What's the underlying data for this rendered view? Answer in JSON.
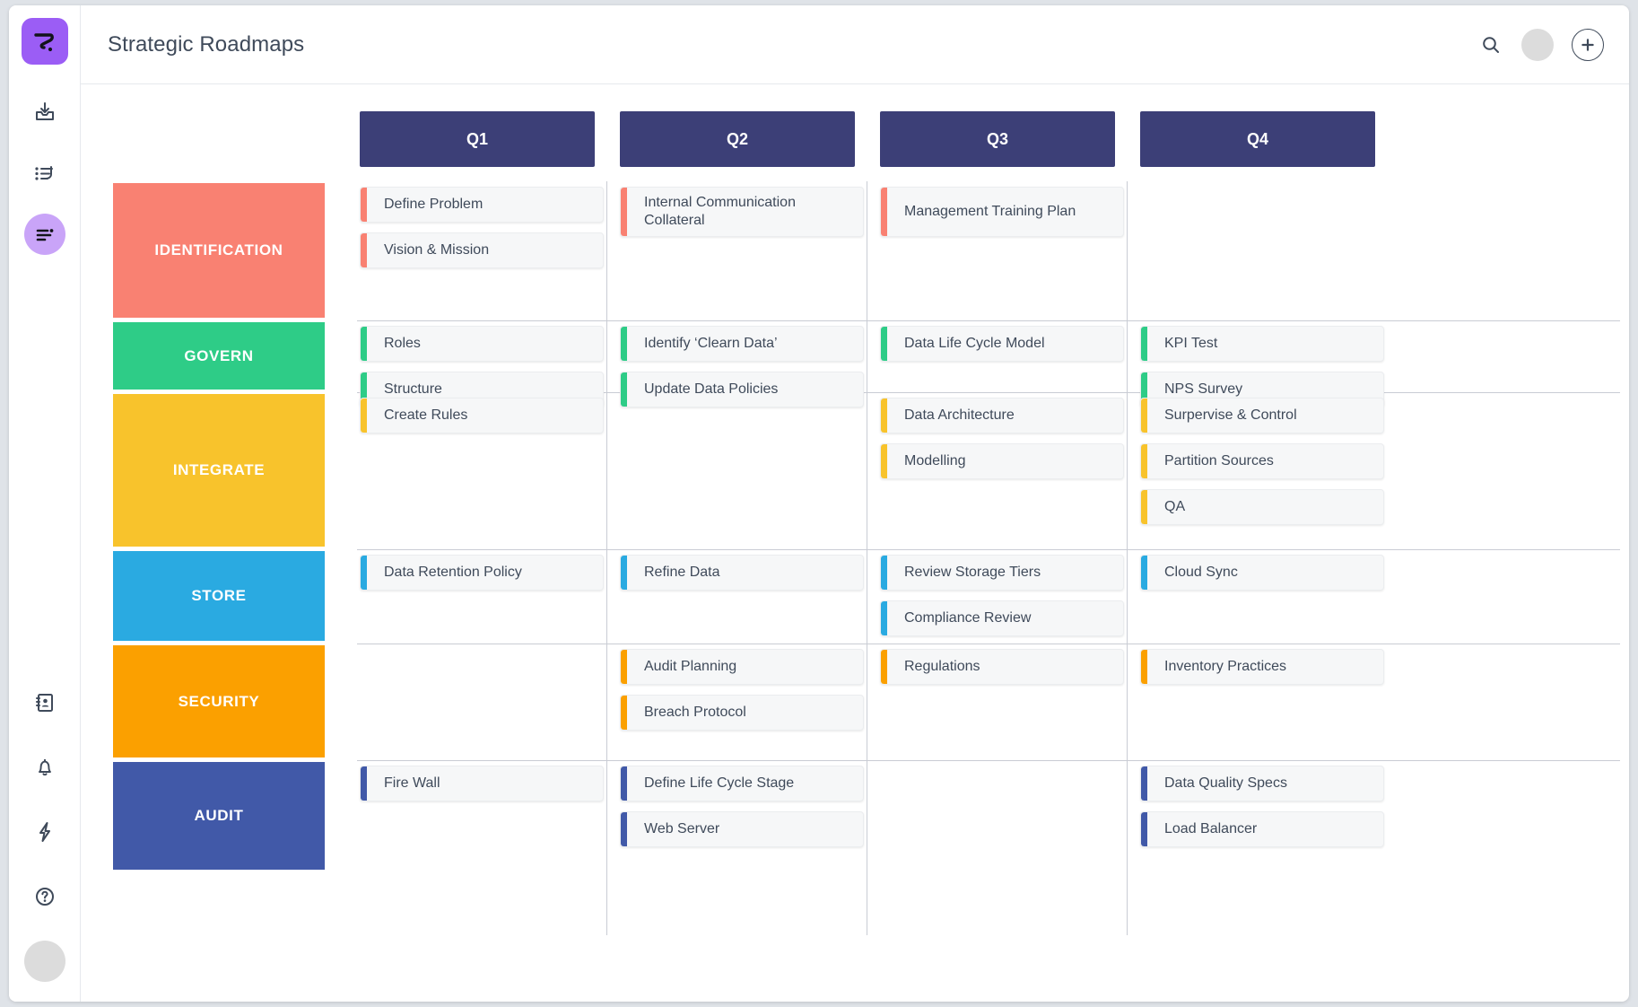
{
  "window": {
    "title": "Strategic Roadmaps"
  },
  "sidebar": {
    "logo": {
      "name": "app-logo",
      "glyph": "logo-squiggle"
    },
    "items": [
      {
        "id": "inbox-download",
        "icon": "inbox-download-icon",
        "label": "",
        "active": false
      },
      {
        "id": "task-list",
        "icon": "list-reply-icon",
        "label": "",
        "active": false
      },
      {
        "id": "roadmap",
        "icon": "roadmap-lines-icon",
        "label": "",
        "active": true
      }
    ],
    "bottom_items": [
      {
        "id": "contacts",
        "icon": "address-book-icon",
        "label": ""
      },
      {
        "id": "notifications",
        "icon": "bell-icon",
        "label": ""
      },
      {
        "id": "automation",
        "icon": "lightning-bolt-icon",
        "label": ""
      },
      {
        "id": "help",
        "icon": "help-circle-icon",
        "label": ""
      }
    ],
    "avatar": {
      "name": "user-avatar",
      "label": ""
    }
  },
  "topbar": {
    "title": "Strategic Roadmaps",
    "search_icon": "search-icon",
    "avatar": "user-avatar",
    "add_button_label": "+"
  },
  "board": {
    "columns": [
      {
        "id": "q1",
        "label": "Q1"
      },
      {
        "id": "q2",
        "label": "Q2"
      },
      {
        "id": "q3",
        "label": "Q3"
      },
      {
        "id": "q4",
        "label": "Q4"
      }
    ],
    "column_header_color": "#3c3f77",
    "rows": [
      {
        "id": "identification",
        "label": "IDENTIFICATION",
        "color": "#f98172",
        "cells": {
          "q1": [
            {
              "label": "Define Problem",
              "tall": false
            },
            {
              "label": "Vision & Mission",
              "tall": false
            }
          ],
          "q2": [
            {
              "label": "Internal Communication Collateral",
              "tall": true
            }
          ],
          "q3": [
            {
              "label": "Management Training Plan",
              "tall": true
            }
          ],
          "q4": []
        }
      },
      {
        "id": "govern",
        "label": "GOVERN",
        "color": "#2ecc87",
        "cells": {
          "q1": [
            {
              "label": "Roles",
              "tall": false
            },
            {
              "label": "Structure",
              "tall": false
            }
          ],
          "q2": [
            {
              "label": "Identify ‘Clearn Data’",
              "tall": false
            },
            {
              "label": "Update Data Policies",
              "tall": false
            }
          ],
          "q3": [
            {
              "label": "Data Life Cycle Model",
              "tall": false
            }
          ],
          "q4": [
            {
              "label": "KPI Test",
              "tall": false
            },
            {
              "label": "NPS Survey",
              "tall": false
            }
          ]
        }
      },
      {
        "id": "integrate",
        "label": "INTEGRATE",
        "color": "#f8c32c",
        "cells": {
          "q1": [
            {
              "label": "Create Rules",
              "tall": false
            }
          ],
          "q2": [],
          "q3": [
            {
              "label": "Data Architecture",
              "tall": false
            },
            {
              "label": "Modelling",
              "tall": false
            }
          ],
          "q4": [
            {
              "label": "Surpervise & Control",
              "tall": false
            },
            {
              "label": "Partition Sources",
              "tall": false
            },
            {
              "label": "QA",
              "tall": false
            }
          ]
        }
      },
      {
        "id": "store",
        "label": "STORE",
        "color": "#2aaae1",
        "cells": {
          "q1": [
            {
              "label": "Data Retention Policy",
              "tall": false
            }
          ],
          "q2": [
            {
              "label": "Refine Data",
              "tall": false
            }
          ],
          "q3": [
            {
              "label": "Review Storage Tiers",
              "tall": false
            },
            {
              "label": "Compliance Review",
              "tall": false
            }
          ],
          "q4": [
            {
              "label": "Cloud Sync",
              "tall": false
            }
          ]
        }
      },
      {
        "id": "security",
        "label": "SECURITY",
        "color": "#fba000",
        "cells": {
          "q1": [],
          "q2": [
            {
              "label": "Audit Planning",
              "tall": false
            },
            {
              "label": "Breach Protocol",
              "tall": false
            }
          ],
          "q3": [
            {
              "label": "Regulations",
              "tall": false
            }
          ],
          "q4": [
            {
              "label": "Inventory Practices",
              "tall": false
            }
          ]
        }
      },
      {
        "id": "audit",
        "label": "AUDIT",
        "color": "#4159a8",
        "cells": {
          "q1": [
            {
              "label": "Fire Wall",
              "tall": false
            }
          ],
          "q2": [
            {
              "label": "Define Life Cycle Stage",
              "tall": false
            },
            {
              "label": "Web Server",
              "tall": false
            }
          ],
          "q3": [],
          "q4": [
            {
              "label": "Data Quality Specs",
              "tall": false
            },
            {
              "label": "Load Balancer",
              "tall": false
            }
          ]
        }
      }
    ]
  }
}
